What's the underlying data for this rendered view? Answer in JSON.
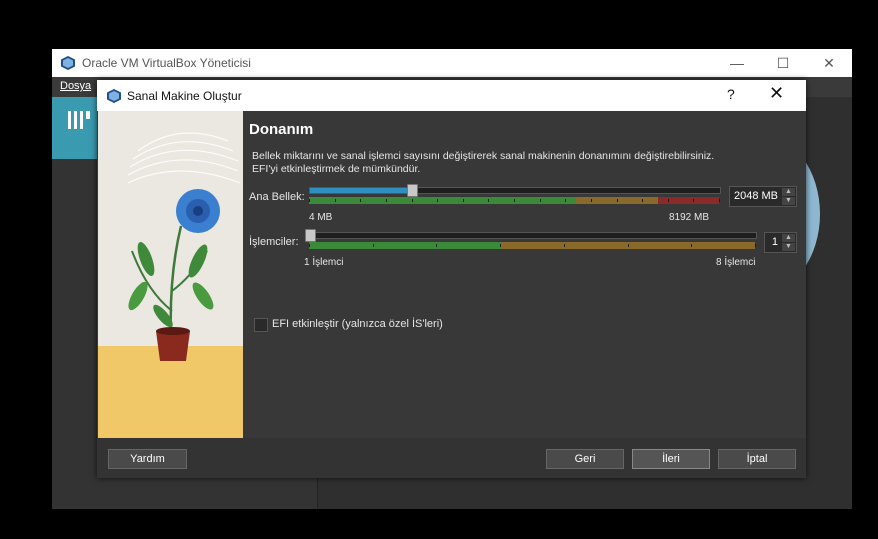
{
  "main_window": {
    "title": "Oracle VM VirtualBox Yöneticisi",
    "menu": [
      "Dosya"
    ],
    "controls": {
      "minimize": "—",
      "maximize": "☐",
      "close": "✕"
    }
  },
  "dialog": {
    "title": "Sanal Makine Oluştur",
    "help": "?",
    "close": "✕",
    "heading": "Donanım",
    "description_line1": "Bellek miktarını ve sanal işlemci sayısını değiştirerek sanal makinenin donanımını değiştirebilirsiniz.",
    "description_line2": "EFI'yi etkinleştirmek de mümkündür.",
    "memory": {
      "label": "Ana Bellek:",
      "value": "2048 MB",
      "min_label": "4 MB",
      "max_label": "8192 MB",
      "value_mb": 2048,
      "min_mb": 4,
      "max_mb": 8192
    },
    "cpu": {
      "label": "İşlemciler:",
      "value": "1",
      "min_label": "1 İşlemci",
      "max_label": "8 İşlemci",
      "value_count": 1,
      "min_count": 1,
      "max_count": 8
    },
    "efi": {
      "label": "EFI etkinleştir (yalnızca özel İS'leri)",
      "checked": false
    },
    "buttons": {
      "help": "Yardım",
      "back": "Geri",
      "next": "İleri",
      "cancel": "İptal"
    }
  },
  "colors": {
    "slider_fill": "#2f8fbf",
    "zone_good": "#3a8a3a",
    "zone_warn": "#8a6a2a",
    "zone_bad": "#8a2a2a",
    "accent_tile": "#3a9bb0"
  },
  "icons": [
    "virtualbox-icon",
    "tools-icon",
    "spin-up-icon",
    "spin-down-icon"
  ]
}
